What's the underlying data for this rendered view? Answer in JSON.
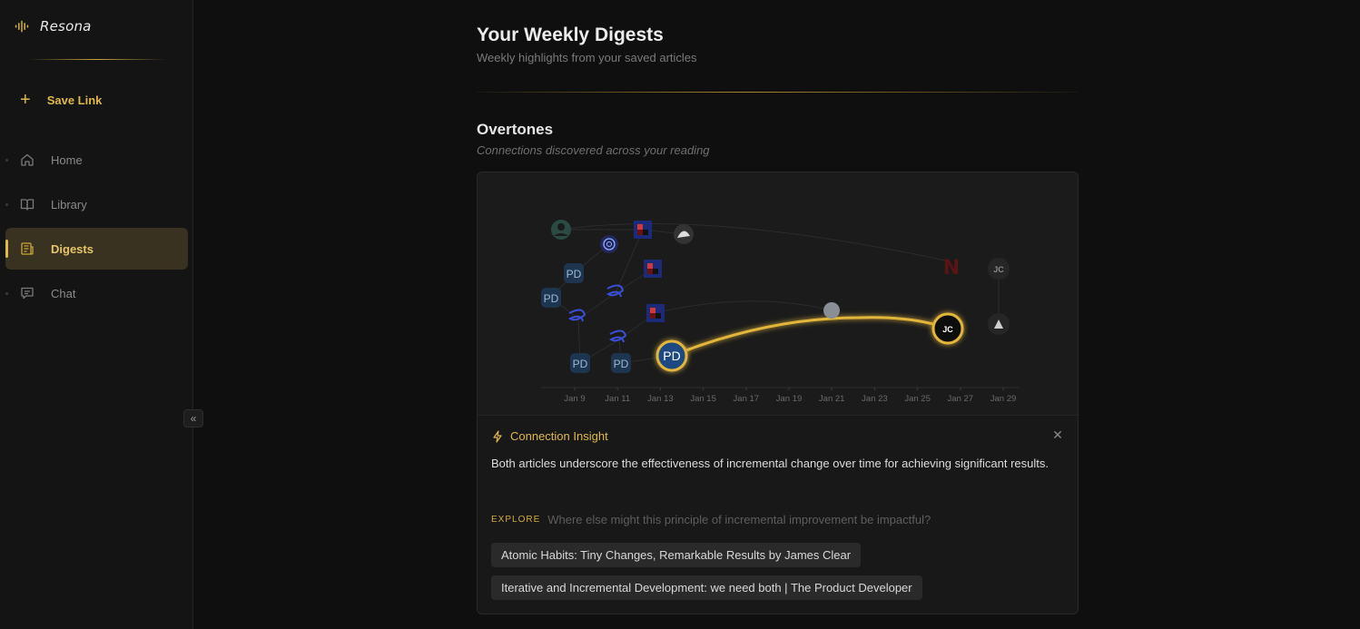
{
  "brand": {
    "name": "Resona"
  },
  "sidebar": {
    "save_link": "Save Link",
    "items": [
      {
        "label": "Home",
        "icon": "home-icon",
        "active": false
      },
      {
        "label": "Library",
        "icon": "book-icon",
        "active": false
      },
      {
        "label": "Digests",
        "icon": "newspaper-icon",
        "active": true
      },
      {
        "label": "Chat",
        "icon": "chat-icon",
        "active": false
      }
    ],
    "collapse": "«"
  },
  "page": {
    "title": "Your Weekly Digests",
    "subtitle": "Weekly highlights from your saved articles"
  },
  "overtones": {
    "title": "Overtones",
    "subtitle": "Connections discovered across your reading",
    "x_axis_ticks": [
      "Jan 9",
      "Jan 11",
      "Jan 13",
      "Jan 15",
      "Jan 17",
      "Jan 19",
      "Jan 21",
      "Jan 23",
      "Jan 25",
      "Jan 27",
      "Jan 29"
    ],
    "nodes": {
      "pd_label": "PD",
      "jc_label": "JC"
    }
  },
  "insight": {
    "title": "Connection Insight",
    "text": "Both articles underscore the effectiveness of incremental change over time for achieving significant results.",
    "explore_tag": "EXPLORE",
    "explore_question": "Where else might this principle of incremental improvement be impactful?",
    "articles": [
      "Atomic Habits: Tiny Changes, Remarkable Results by James Clear",
      "Iterative and Incremental Development: we need both | The Product Developer"
    ]
  },
  "colors": {
    "accent": "#e0b84a",
    "highlight_line": "#e2b53b",
    "background": "#0f0f0f",
    "sidebar": "#141414",
    "active_nav": "#3a3220"
  }
}
